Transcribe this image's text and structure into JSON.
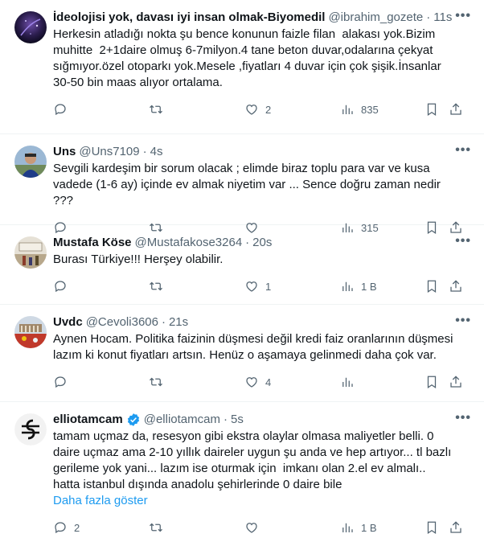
{
  "tweets": [
    {
      "name": "İdeolojisi yok, davası iyi insan olmak-Biyomedil",
      "handle": "@ibrahim_gozete",
      "separator": "·",
      "time": "11s",
      "text": "Herkesin atladığı nokta şu bence konunun faizle filan  alakası yok.Bizim muhitte  2+1daire olmuş 6-7milyon.4 tane beton duvar,odalarına çekyat sığmıyor.özel otoparkı yok.Mesele ,fiyatları 4 duvar için çok şişik.İnsanlar 30-50 bin maas alıyor ortalama.",
      "replies": "",
      "retweets": "",
      "likes": "2",
      "views": "835"
    },
    {
      "name": "Uns",
      "handle": "@Uns7109",
      "separator": "·",
      "time": "4s",
      "text": "Sevgili kardeşim bir sorum olacak ; elimde biraz toplu para var ve kusa vadede (1-6 ay) içinde ev almak niyetim var ... Sence doğru zaman nedir ???",
      "replies": "",
      "retweets": "",
      "likes": "",
      "views": "315"
    },
    {
      "name": "Mustafa Köse",
      "handle": "@Mustafakose3264",
      "separator": "·",
      "time": "20s",
      "text": "Burası Türkiye!!! Herşey olabilir.",
      "replies": "",
      "retweets": "",
      "likes": "1",
      "views": "1 B"
    },
    {
      "name": "Uvdc",
      "handle": "@Cevoli3606",
      "separator": "·",
      "time": "21s",
      "text": "Aynen Hocam. Politika faizinin düşmesi değil kredi faiz oranlarının düşmesi lazım ki konut fiyatları artsın. Henüz o aşamaya gelinmedi daha çok var.",
      "replies": "",
      "retweets": "",
      "likes": "4",
      "views": ""
    },
    {
      "name": "elliotamcam",
      "handle": "@elliotamcam",
      "separator": "·",
      "time": "5s",
      "text": "tamam uçmaz da, resesyon gibi ekstra olaylar olmasa maliyetler belli. 0 daire uçmaz ama 2-10 yıllık daireler uygun şu anda ve hep artıyor... tl bazlı gerileme yok yani... lazım ise oturmak için  imkanı olan 2.el ev almalı.. hatta istanbul dışında anadolu şehirlerinde 0 daire bile",
      "show_more": "Daha fazla göster",
      "replies": "2",
      "retweets": "",
      "likes": "",
      "views": "1 B"
    }
  ],
  "more_glyph": "•••",
  "colors": {
    "text": "#0f1419",
    "muted": "#536471",
    "link": "#1d9bf0",
    "divider": "#eff3f4",
    "verified": "#1d9bf0"
  },
  "icons": [
    "reply-icon",
    "retweet-icon",
    "like-icon",
    "views-icon",
    "bookmark-icon",
    "share-icon",
    "more-icon",
    "verified-badge-icon"
  ]
}
